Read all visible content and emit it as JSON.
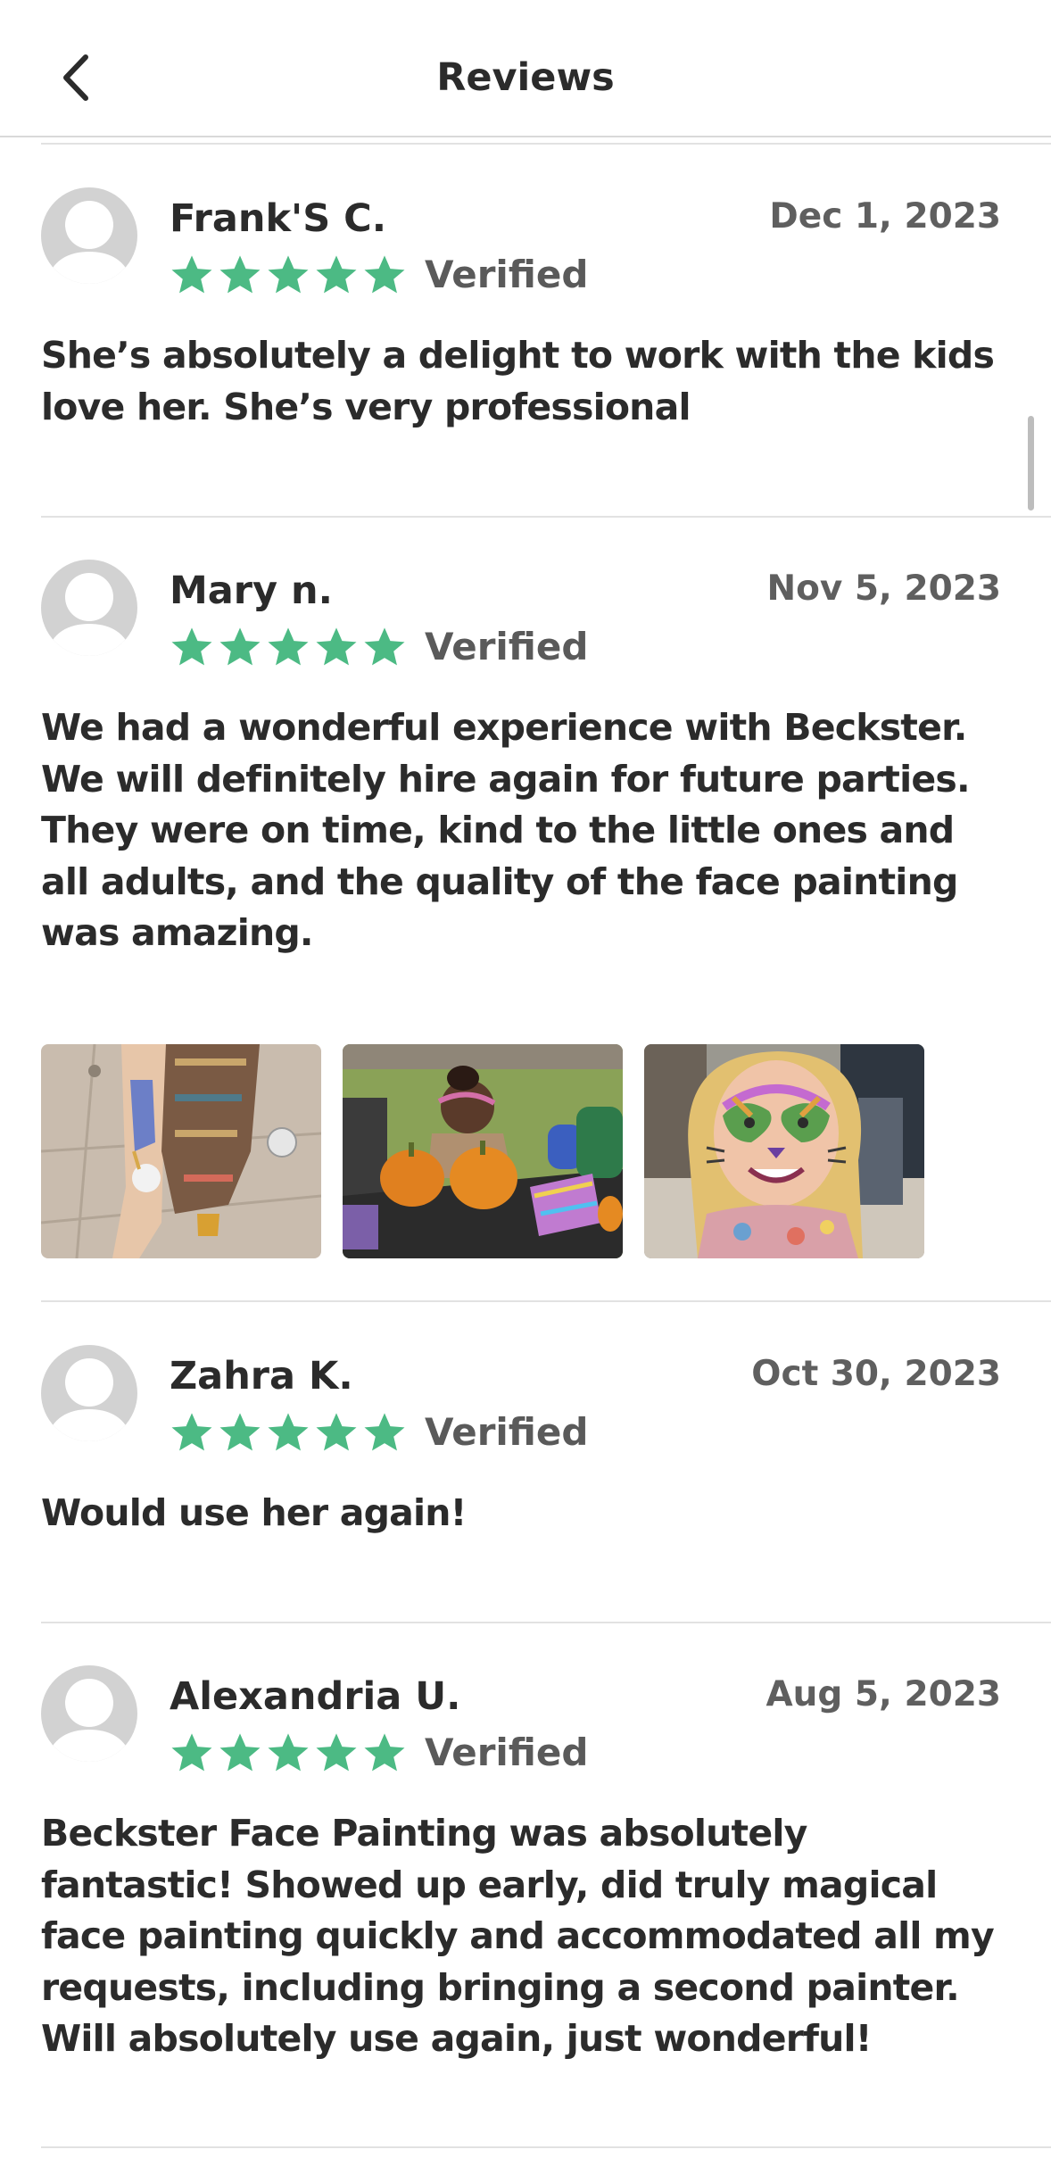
{
  "header": {
    "title": "Reviews"
  },
  "colors": {
    "star": "#4cba84",
    "avatar": "#d2d2d2"
  },
  "reviews": [
    {
      "name": "Frank'S C.",
      "date": "Dec 1, 2023",
      "rating": 5,
      "verified": "Verified",
      "text": "She’s absolutely a delight to work with the kids love her. She’s very professional"
    },
    {
      "name": "Mary n.",
      "date": "Nov 5, 2023",
      "rating": 5,
      "verified": "Verified",
      "text": "We had a wonderful experience with Beckster. We will definitely hire again for future parties. They were on time, kind to the little ones and all adults, and the quality of the face painting was amazing.",
      "photos": [
        "unicorn-leg-painting-photo",
        "child-pumpkin-table-photo",
        "girl-tiger-face-paint-photo"
      ]
    },
    {
      "name": "Zahra K.",
      "date": "Oct 30, 2023",
      "rating": 5,
      "verified": "Verified",
      "text": "Would use her again!"
    },
    {
      "name": "Alexandria U.",
      "date": "Aug 5, 2023",
      "rating": 5,
      "verified": "Verified",
      "text": "Beckster Face Painting was absolutely fantastic! Showed up early, did truly magical face painting quickly and accommodated all my requests, including bringing a second painter. Will absolutely use again, just wonderful!"
    }
  ]
}
